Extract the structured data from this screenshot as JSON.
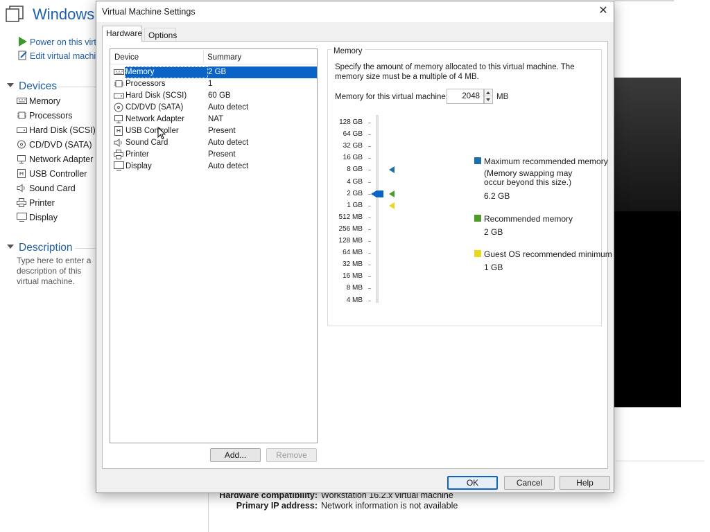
{
  "background": {
    "title": "Windows",
    "actions": [
      {
        "label": "Power on this virtual machine",
        "icon": "play-icon"
      },
      {
        "label": "Edit virtual machine settings",
        "icon": "edit-icon"
      }
    ],
    "devices_heading": "Devices",
    "devices": [
      {
        "label": "Memory",
        "icon": "memory-icon"
      },
      {
        "label": "Processors",
        "icon": "processor-icon"
      },
      {
        "label": "Hard Disk (SCSI)",
        "icon": "hard-disk-icon"
      },
      {
        "label": "CD/DVD (SATA)",
        "icon": "cd-dvd-icon"
      },
      {
        "label": "Network Adapter",
        "icon": "network-adapter-icon"
      },
      {
        "label": "USB Controller",
        "icon": "usb-controller-icon"
      },
      {
        "label": "Sound Card",
        "icon": "sound-card-icon"
      },
      {
        "label": "Printer",
        "icon": "printer-icon"
      },
      {
        "label": "Display",
        "icon": "display-icon"
      }
    ],
    "description_heading": "Description",
    "description_placeholder": "Type here to enter a description of this virtual machine.",
    "info": [
      {
        "key": "Hardware compatibility:",
        "value": "Workstation 16.2.x virtual machine"
      },
      {
        "key": "Primary IP address:",
        "value": "Network information is not available"
      }
    ]
  },
  "dialog": {
    "title": "Virtual Machine Settings",
    "close_glyph": "✕",
    "tabs": [
      "Hardware",
      "Options"
    ],
    "active_tab": "Hardware",
    "device_list": {
      "header_device": "Device",
      "header_summary": "Summary",
      "rows": [
        {
          "device": "Memory",
          "summary": "2 GB",
          "icon": "memory-icon",
          "selected": true
        },
        {
          "device": "Processors",
          "summary": "1",
          "icon": "processor-icon"
        },
        {
          "device": "Hard Disk (SCSI)",
          "summary": "60 GB",
          "icon": "hard-disk-icon"
        },
        {
          "device": "CD/DVD (SATA)",
          "summary": "Auto detect",
          "icon": "cd-dvd-icon"
        },
        {
          "device": "Network Adapter",
          "summary": "NAT",
          "icon": "network-adapter-icon"
        },
        {
          "device": "USB Controller",
          "summary": "Present",
          "icon": "usb-controller-icon"
        },
        {
          "device": "Sound Card",
          "summary": "Auto detect",
          "icon": "sound-card-icon"
        },
        {
          "device": "Printer",
          "summary": "Present",
          "icon": "printer-icon"
        },
        {
          "device": "Display",
          "summary": "Auto detect",
          "icon": "display-icon"
        }
      ]
    },
    "add_button": "Add...",
    "remove_button": "Remove",
    "memory": {
      "group_label": "Memory",
      "description": "Specify the amount of memory allocated to this virtual machine. The memory size must be a multiple of 4 MB.",
      "field_label": "Memory for this virtual machine:",
      "value": "2048",
      "unit": "MB",
      "scale_labels": [
        "128 GB",
        "64 GB",
        "32 GB",
        "16 GB",
        "8 GB",
        "4 GB",
        "2 GB",
        "1 GB",
        "512 MB",
        "256 MB",
        "128 MB",
        "64 MB",
        "32 MB",
        "16 MB",
        "8 MB",
        "4 MB"
      ],
      "slider_value_label": "2 GB",
      "max_recommended_label": "8 GB",
      "recommended_label": "2 GB",
      "guest_min_label": "1 GB",
      "legend": {
        "max_recommended": {
          "title": "Maximum recommended memory",
          "note": "(Memory swapping may occur beyond this size.)",
          "value": "6.2 GB",
          "color": "#1f6fa8"
        },
        "recommended": {
          "title": "Recommended memory",
          "value": "2 GB",
          "color": "#4e9a2a"
        },
        "guest_min": {
          "title": "Guest OS recommended minimum",
          "value": "1 GB",
          "color": "#e8d81e"
        }
      }
    },
    "buttons": {
      "ok": "OK",
      "cancel": "Cancel",
      "help": "Help"
    }
  },
  "colors": {
    "accent": "#0a64c8",
    "link": "#1f5fa8"
  }
}
